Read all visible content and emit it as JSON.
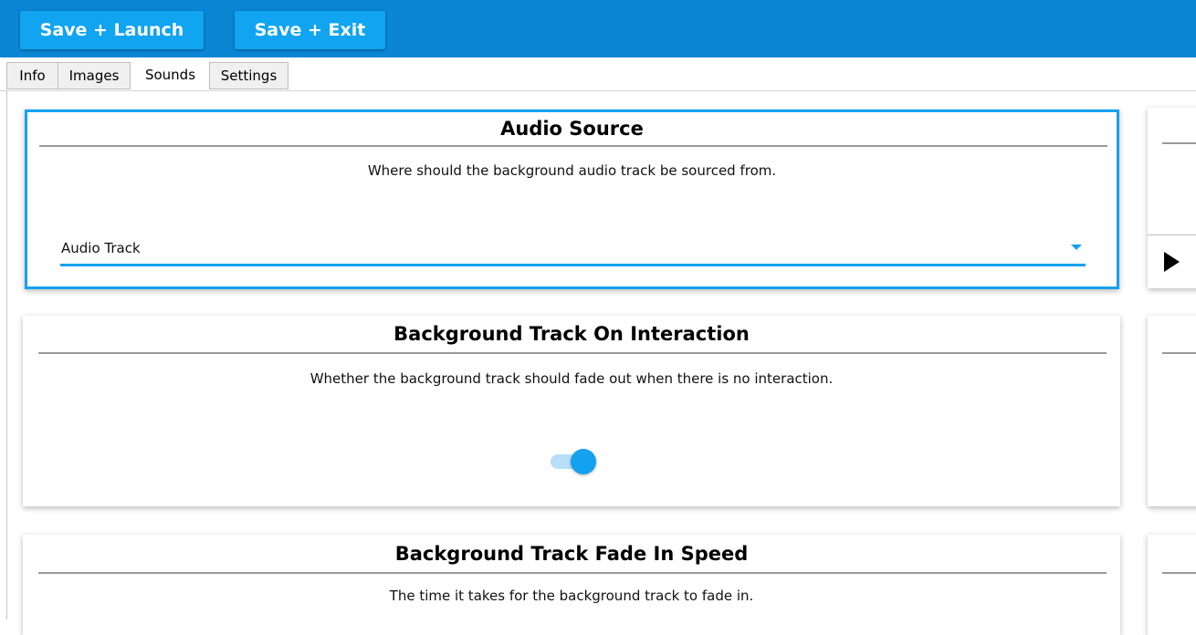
{
  "toolbar": {
    "save_launch_label": "Save + Launch",
    "save_exit_label": "Save + Exit"
  },
  "tabs": [
    {
      "label": "Info"
    },
    {
      "label": "Images"
    },
    {
      "label": "Sounds"
    },
    {
      "label": "Settings"
    }
  ],
  "cards": {
    "audio_source": {
      "title": "Audio Source",
      "description": "Where should the background audio track be sourced from.",
      "selected_value": "Audio Track"
    },
    "interaction": {
      "title": "Background Track On Interaction",
      "description": "Whether the background track should fade out when there is no interaction.",
      "toggle_on": true
    },
    "fade_in": {
      "title": "Background Track Fade In Speed",
      "description": "The time it takes for the background track to fade in."
    }
  },
  "colors": {
    "toolbar": "#0a86d4",
    "button": "#11a4f0",
    "accent": "#13a1f0"
  },
  "icons": {
    "dropdown": "chevron-down-icon",
    "play": "play-icon"
  }
}
